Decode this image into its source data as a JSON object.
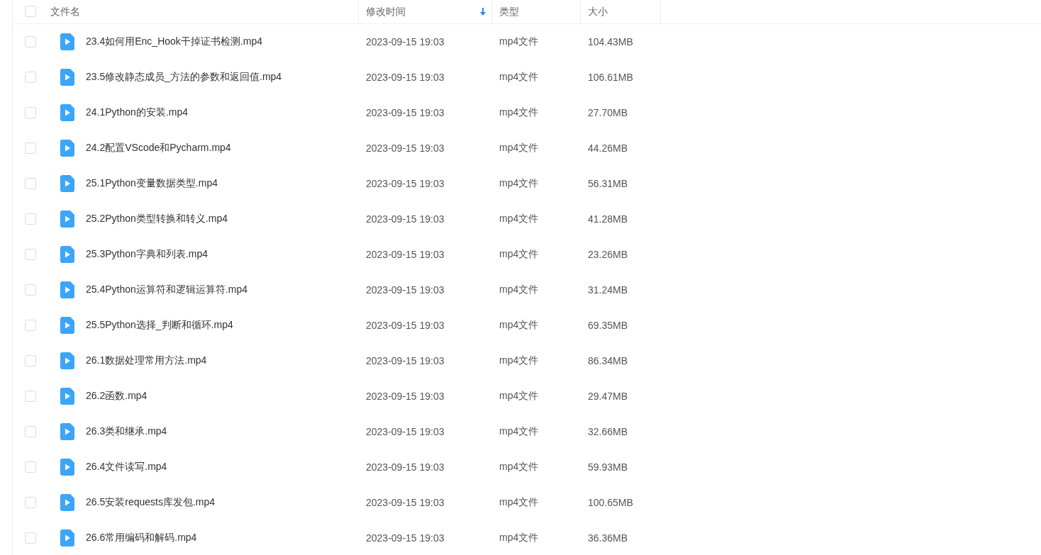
{
  "header": {
    "select_all": {
      "checked": false
    },
    "columns": [
      {
        "label": "文件名",
        "sorted": false
      },
      {
        "label": "修改时间",
        "sorted": true
      },
      {
        "label": "类型",
        "sorted": false
      },
      {
        "label": "大小",
        "sorted": false
      }
    ]
  },
  "rows": [
    {
      "name": "23.4如何用Enc_Hook干掉证书检测.mp4",
      "modified": "2023-09-15 19:03",
      "type": "mp4文件",
      "size": "104.43MB",
      "checked": false
    },
    {
      "name": "23.5修改静态成员_方法的参数和返回值.mp4",
      "modified": "2023-09-15 19:03",
      "type": "mp4文件",
      "size": "106.61MB",
      "checked": false
    },
    {
      "name": "24.1Python的安装.mp4",
      "modified": "2023-09-15 19:03",
      "type": "mp4文件",
      "size": "27.70MB",
      "checked": false
    },
    {
      "name": "24.2配置VScode和Pycharm.mp4",
      "modified": "2023-09-15 19:03",
      "type": "mp4文件",
      "size": "44.26MB",
      "checked": false
    },
    {
      "name": "25.1Python变量数据类型.mp4",
      "modified": "2023-09-15 19:03",
      "type": "mp4文件",
      "size": "56.31MB",
      "checked": false
    },
    {
      "name": "25.2Python类型转换和转义.mp4",
      "modified": "2023-09-15 19:03",
      "type": "mp4文件",
      "size": "41.28MB",
      "checked": false
    },
    {
      "name": "25.3Python字典和列表.mp4",
      "modified": "2023-09-15 19:03",
      "type": "mp4文件",
      "size": "23.26MB",
      "checked": false
    },
    {
      "name": "25.4Python运算符和逻辑运算符.mp4",
      "modified": "2023-09-15 19:03",
      "type": "mp4文件",
      "size": "31.24MB",
      "checked": false
    },
    {
      "name": "25.5Python选择_判断和循环.mp4",
      "modified": "2023-09-15 19:03",
      "type": "mp4文件",
      "size": "69.35MB",
      "checked": false
    },
    {
      "name": "26.1数据处理常用方法.mp4",
      "modified": "2023-09-15 19:03",
      "type": "mp4文件",
      "size": "86.34MB",
      "checked": false
    },
    {
      "name": "26.2函数.mp4",
      "modified": "2023-09-15 19:03",
      "type": "mp4文件",
      "size": "29.47MB",
      "checked": false
    },
    {
      "name": "26.3类和继承.mp4",
      "modified": "2023-09-15 19:03",
      "type": "mp4文件",
      "size": "32.66MB",
      "checked": false
    },
    {
      "name": "26.4文件读写.mp4",
      "modified": "2023-09-15 19:03",
      "type": "mp4文件",
      "size": "59.93MB",
      "checked": false
    },
    {
      "name": "26.5安装requests库发包.mp4",
      "modified": "2023-09-15 19:03",
      "type": "mp4文件",
      "size": "100.65MB",
      "checked": false
    },
    {
      "name": "26.6常用编码和解码.mp4",
      "modified": "2023-09-15 19:03",
      "type": "mp4文件",
      "size": "36.36MB",
      "checked": false
    }
  ]
}
